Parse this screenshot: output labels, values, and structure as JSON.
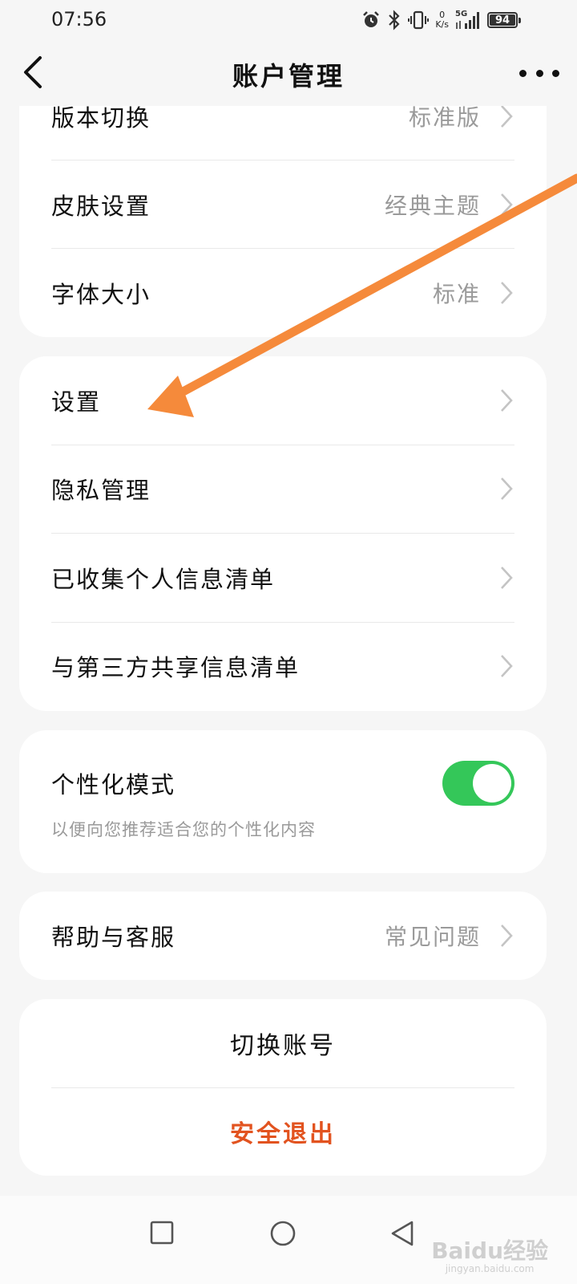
{
  "status_bar": {
    "time": "07:56",
    "net_speed_value": "0",
    "net_speed_unit": "K/s",
    "network": "5G",
    "battery": "94",
    "icons": [
      "alarm-icon",
      "bluetooth-icon",
      "vibrate-icon",
      "signal-icon",
      "battery-icon"
    ]
  },
  "header": {
    "title": "账户管理",
    "back_icon": "chevron-left-icon",
    "more_icon": "more-dots-icon"
  },
  "card1": {
    "items": [
      {
        "label": "版本切换",
        "value": "标准版"
      },
      {
        "label": "皮肤设置",
        "value": "经典主题"
      },
      {
        "label": "字体大小",
        "value": "标准"
      }
    ]
  },
  "card2": {
    "items": [
      {
        "label": "设置"
      },
      {
        "label": "隐私管理"
      },
      {
        "label": "已收集个人信息清单"
      },
      {
        "label": "与第三方共享信息清单"
      }
    ]
  },
  "card3": {
    "label": "个性化模式",
    "description": "以便向您推荐适合您的个性化内容",
    "toggle_on": true,
    "toggle_color": "#34c759"
  },
  "card4": {
    "label": "帮助与客服",
    "value": "常见问题"
  },
  "card5": {
    "switch_account": "切换账号",
    "logout": "安全退出",
    "logout_color": "#e2531f"
  },
  "annotation_arrow_color": "#f58a3b",
  "nav_bar": {
    "icons": [
      "recent-apps-icon",
      "home-icon",
      "back-triangle-icon"
    ]
  },
  "watermark": {
    "text": "Baidu经验",
    "url": "jingyan.baidu.com"
  }
}
